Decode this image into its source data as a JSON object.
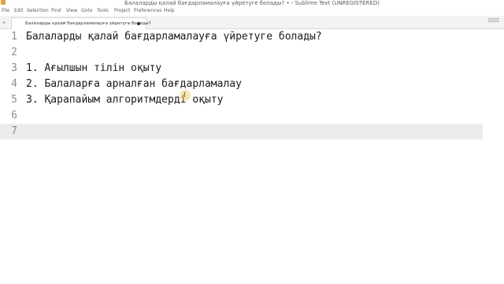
{
  "window": {
    "title": "Балаларды қалай бағдарламалауға үйретуге болады? • - Sublime Text (UNREGISTERED)"
  },
  "menu": {
    "items": [
      "File",
      "Edit",
      "Selection",
      "Find",
      "View",
      "Goto",
      "Tools",
      "Project",
      "Preferences",
      "Help"
    ]
  },
  "tabs": [
    {
      "label": "Балаларды қалай бағдарламалауға үйретуге болады?",
      "dirty": true
    }
  ],
  "editor": {
    "current_line": 7,
    "lines": [
      {
        "number": "1",
        "text": "Балаларды қалай бағдарламалауға үйретуге болады?"
      },
      {
        "number": "2",
        "text": ""
      },
      {
        "number": "3",
        "text": "1. Ағылшын тілін оқыту"
      },
      {
        "number": "4",
        "text": "2. Балаларға арналған бағдарламалау"
      },
      {
        "number": "5",
        "text": "3. Қарапайым алгоритмдерді оқыту"
      },
      {
        "number": "6",
        "text": ""
      },
      {
        "number": "7",
        "text": ""
      }
    ]
  },
  "icons": {
    "app": "sublime-text-icon",
    "dirty": "unsaved-dot-icon",
    "cursor": "i-beam-cursor-icon"
  }
}
